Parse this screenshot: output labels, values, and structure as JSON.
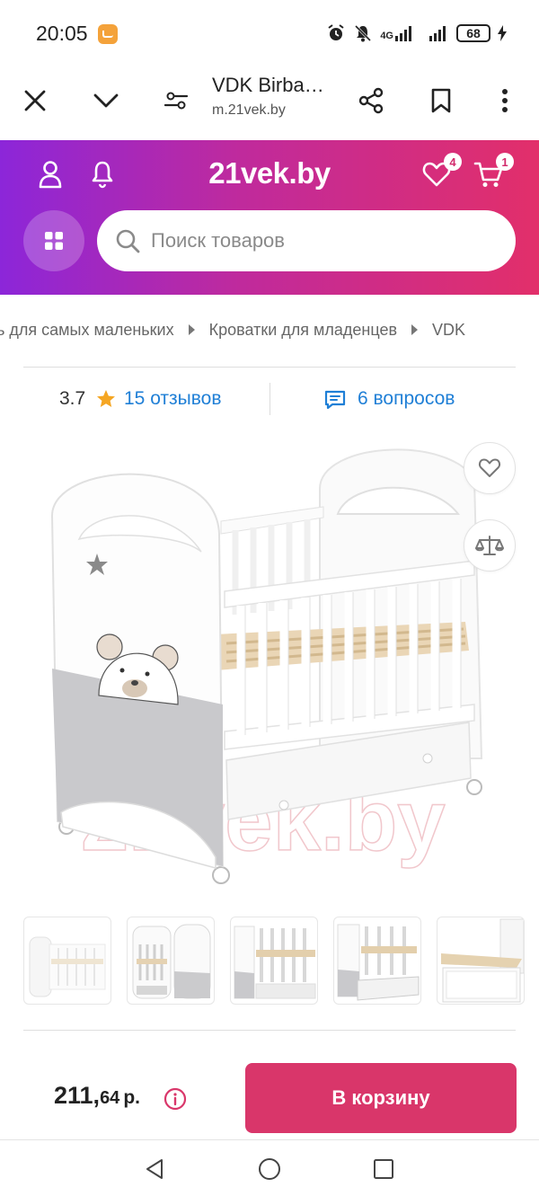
{
  "status_bar": {
    "time": "20:05",
    "network": "4G",
    "battery": "68"
  },
  "browser": {
    "title": "VDK Birba…",
    "domain": "m.21vek.by"
  },
  "header": {
    "logo": "21vek.by",
    "favorites_count": "4",
    "cart_count": "1",
    "search_placeholder": "Поиск товаров"
  },
  "breadcrumb": {
    "items": [
      "ь для самых маленьких",
      "Кроватки для младенцев",
      "VDK"
    ]
  },
  "rating": {
    "value": "3.7",
    "reviews": "15 отзывов",
    "questions": "6 вопросов"
  },
  "watermark": "21vek.by",
  "price": {
    "integer": "211,",
    "fraction": "64",
    "currency": "р."
  },
  "cart_button": "В корзину",
  "colors": {
    "accent": "#d9366a",
    "link": "#1f7fd6",
    "star": "#f5a623",
    "header_start": "#8c26d9",
    "header_end": "#e22f6a"
  }
}
